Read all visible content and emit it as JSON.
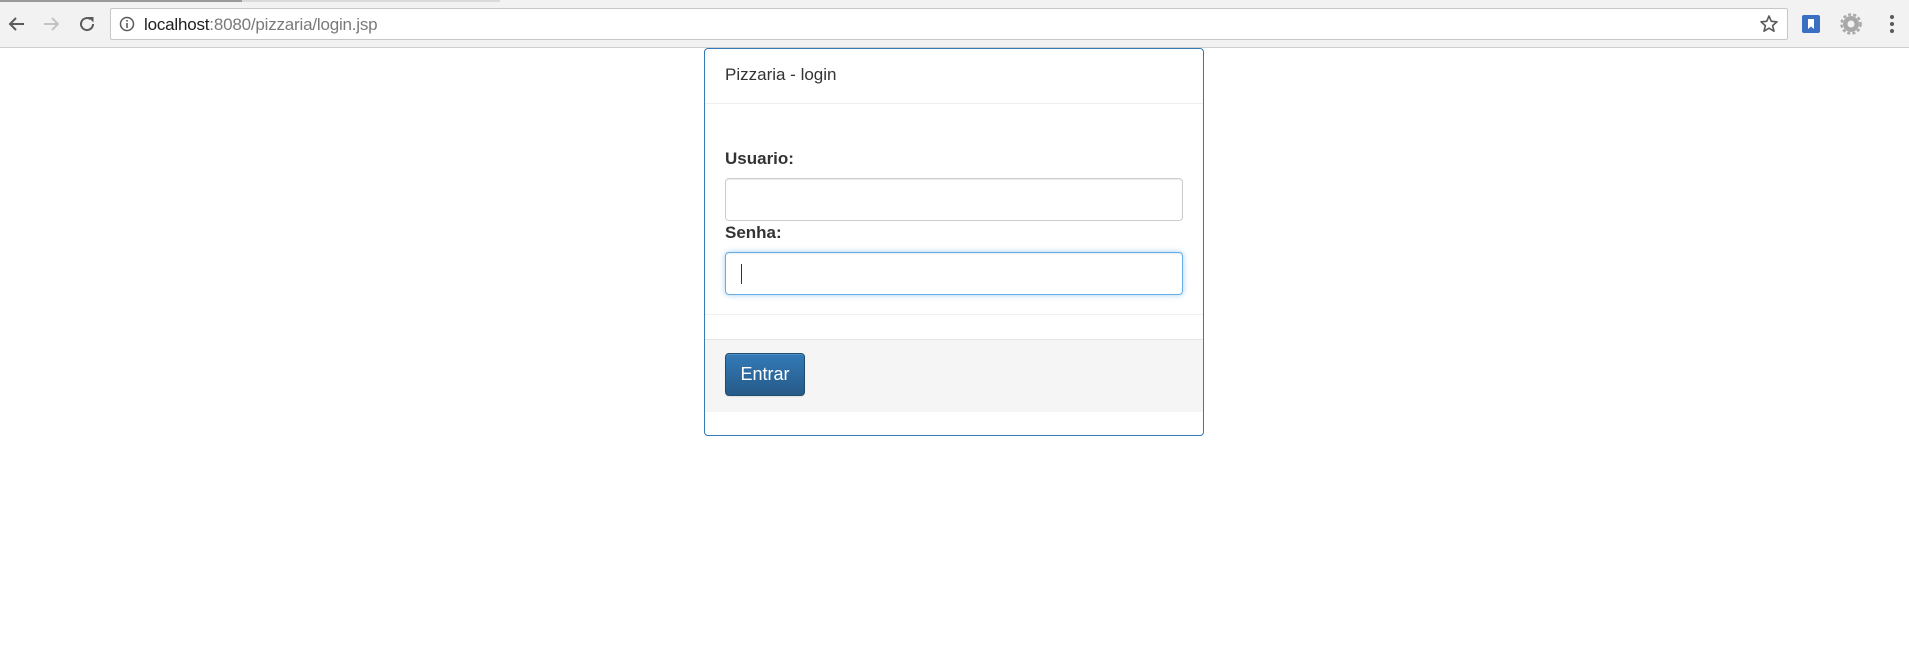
{
  "browser": {
    "url_host": "localhost",
    "url_rest": ":8080/pizzaria/login.jsp"
  },
  "panel": {
    "title": "Pizzaria - login",
    "accent_color": "#337ab7"
  },
  "form": {
    "username_label": "Usuario:",
    "username_value": "",
    "password_label": "Senha:",
    "password_value": "",
    "submit_label": "Entrar"
  },
  "icons": {
    "back": "arrow-left",
    "forward": "arrow-right",
    "reload": "reload",
    "site_info": "info-circle",
    "bookmark_star": "star-outline",
    "extension_bookmark": "bookmark",
    "extension_settings": "gear",
    "browser_menu": "vertical-dots"
  }
}
